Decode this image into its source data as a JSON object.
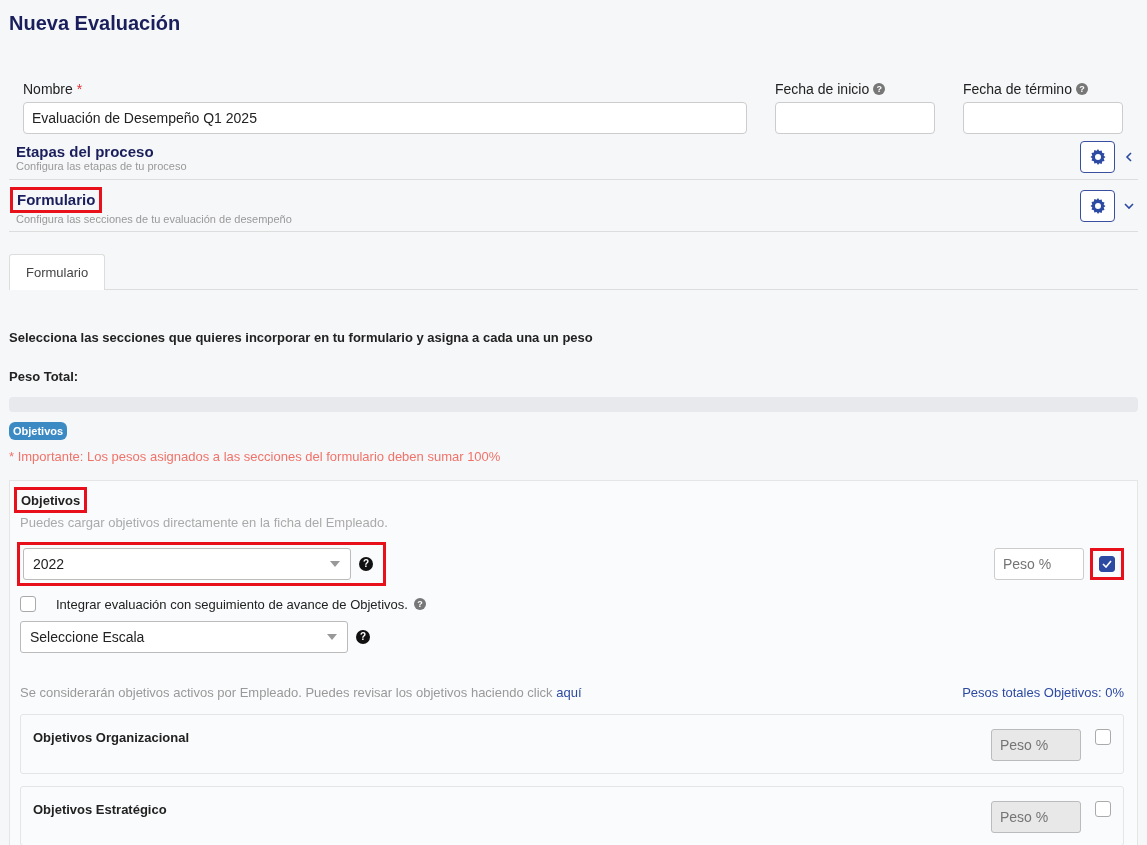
{
  "page_title": "Nueva Evaluación",
  "fields": [
    {
      "label": "Nombre",
      "required_mark": "*",
      "value": "Evaluación de Desempeño Q1 2025",
      "kind": "wide"
    },
    {
      "label": "Fecha de inicio",
      "help": "?",
      "kind": "date"
    },
    {
      "label": "Fecha de término",
      "help": "?",
      "kind": "date"
    }
  ],
  "sections": [
    {
      "title": "Etapas del proceso",
      "subtitle": "Configura las etapas de tu proceso",
      "expanded": false,
      "highlighted": false
    },
    {
      "title": "Formulario",
      "subtitle": "Configura las secciones de tu evaluación de desempeño",
      "expanded": true,
      "highlighted": true
    }
  ],
  "tabs": [
    {
      "label": "Formulario",
      "selected": true
    }
  ],
  "instruction": "Selecciona las secciones que quieres incorporar en tu formulario y asigna a cada una un peso",
  "peso_total": {
    "label": "Peso Total:",
    "level": 0
  },
  "badges": [
    "Objetivos"
  ],
  "warning": "* Importante: Los pesos asignados a las secciones del formulario deben sumar 100%",
  "objectives_card": {
    "title": "Objetivos",
    "title_highlighted": true,
    "subtitle": "Puedes cargar objetivos directamente en la ficha del Empleado.",
    "year_select": {
      "value": "2022",
      "help": "?",
      "highlighted": true
    },
    "weight_placeholder": "Peso %",
    "enabled": true,
    "enabled_highlighted": true,
    "integrate": {
      "label": "Integrar evaluación con seguimiento de avance de Objetivos.",
      "help": "?",
      "checked": false
    },
    "scale_select": {
      "value": "Seleccione Escala",
      "help": "?"
    },
    "note": "Se considerarán objetivos activos por Empleado. Puedes revisar los objetivos haciendo click",
    "note_link": "aquí",
    "totals": "Pesos totales Objetivos: 0%",
    "groups": [
      {
        "title": "Objetivos Organizacional",
        "placeholder": "Peso %",
        "checked": false
      },
      {
        "title": "Objetivos Estratégico",
        "placeholder": "Peso %",
        "checked": false
      }
    ]
  }
}
